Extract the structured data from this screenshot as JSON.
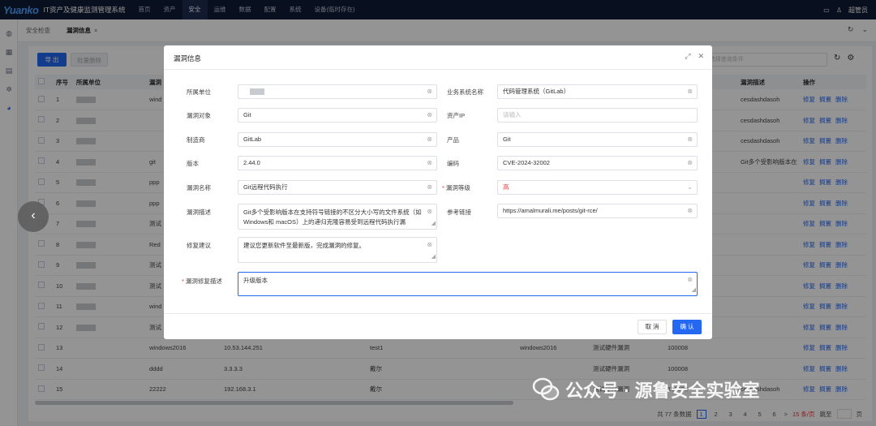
{
  "app": {
    "logo": "Yuanko",
    "title": "IT资产及健康监测管理系统",
    "user": "超管员"
  },
  "nav": [
    "首页",
    "资产",
    "安全",
    "运维",
    "数据",
    "配置",
    "系统",
    "设备(临时存在)"
  ],
  "tabs": [
    "安全检查",
    "漏洞信息"
  ],
  "toolbar": {
    "export": "导 出",
    "batch_delete": "批量删除",
    "search_placeholder": "请选择查询条件"
  },
  "table": {
    "headers": [
      "序号",
      "所属单位",
      "漏洞",
      "",
      "",
      "",
      "",
      "",
      "漏洞描述",
      "操作"
    ],
    "rows": [
      {
        "no": "1",
        "os": "wind",
        "c3": "",
        "c4": "",
        "c5": "",
        "c6": "",
        "c7": "",
        "desc": "cesdashdasoh"
      },
      {
        "no": "2",
        "os": "",
        "c3": "",
        "c4": "",
        "c5": "",
        "c6": "",
        "c7": "",
        "desc": "cesdashdasoh"
      },
      {
        "no": "3",
        "os": "",
        "c3": "",
        "c4": "",
        "c5": "",
        "c6": "",
        "c7": "",
        "desc": "cesdashdasoh"
      },
      {
        "no": "4",
        "os": "git",
        "c3": "",
        "c4": "",
        "c5": "",
        "c6": "",
        "c7": "2",
        "desc": "Git多个受影响版本在"
      },
      {
        "no": "5",
        "os": "ppp",
        "c3": "",
        "c4": "",
        "c5": "",
        "c6": "",
        "c7": "",
        "desc": ""
      },
      {
        "no": "6",
        "os": "ppp",
        "c3": "",
        "c4": "",
        "c5": "",
        "c6": "",
        "c7": "",
        "desc": ""
      },
      {
        "no": "7",
        "os": "测试",
        "c3": "",
        "c4": "",
        "c5": "",
        "c6": "",
        "c7": "",
        "desc": ""
      },
      {
        "no": "8",
        "os": "Red",
        "c3": "",
        "c4": "",
        "c5": "",
        "c6": "",
        "c7": "",
        "desc": ""
      },
      {
        "no": "9",
        "os": "测试",
        "c3": "",
        "c4": "",
        "c5": "",
        "c6": "",
        "c7": "",
        "desc": ""
      },
      {
        "no": "10",
        "os": "测试",
        "c3": "",
        "c4": "",
        "c5": "",
        "c6": "",
        "c7": "",
        "desc": ""
      },
      {
        "no": "11",
        "os": "wind",
        "c3": "",
        "c4": "",
        "c5": "",
        "c6": "",
        "c7": "",
        "desc": ""
      },
      {
        "no": "12",
        "os": "测试",
        "c3": "",
        "c4": "",
        "c5": "",
        "c6": "",
        "c7": "",
        "desc": ""
      },
      {
        "no": "13",
        "os": "windows2016",
        "c3": "10.53.144.251",
        "c4": "test1",
        "c5": "windows2016",
        "c6": "测试硬件漏洞",
        "c7": "100008",
        "desc": ""
      },
      {
        "no": "14",
        "os": "dddd",
        "c3": "3.3.3.3",
        "c4": "戴尔",
        "c5": "",
        "c6": "测试硬件漏洞",
        "c7": "100008",
        "desc": ""
      },
      {
        "no": "15",
        "os": "22222",
        "c3": "192.168.3.1",
        "c4": "戴尔",
        "c5": "",
        "c6": "测试硬件漏洞",
        "c7": "100008",
        "desc": "cesdashdasoh"
      }
    ],
    "ops": [
      "修复",
      "搁置",
      "删除"
    ]
  },
  "pager": {
    "total": "共 77 条数据",
    "pages": [
      "1",
      "2",
      "3",
      "4",
      "5",
      "6"
    ],
    "next": ">",
    "size": "15 条/页",
    "goto": "跳至",
    "page_unit": "页"
  },
  "modal": {
    "title": "漏洞信息",
    "labels": {
      "unit": "所属单位",
      "system": "业务系统名称",
      "target": "漏洞对象",
      "ip": "资产IP",
      "vendor": "制造商",
      "product": "产品",
      "version": "版本",
      "code": "编码",
      "name": "漏洞名称",
      "level": "漏洞等级",
      "desc": "漏洞描述",
      "ref": "参考链接",
      "advice": "修复建议",
      "fix_desc": "漏洞修复描述"
    },
    "values": {
      "unit": "",
      "system": "代码管理系统（GitLab）",
      "target": "Git",
      "ip_placeholder": "请输入",
      "vendor": "GitLab",
      "product": "Git",
      "version": "2.44.0",
      "code": "CVE-2024-32002",
      "name": "Git远程代码执行",
      "level": "高",
      "desc": "Git多个受影响版本在支持符号链接的不区分大小写的文件系统（如Windows和 macOS）上的递归克隆容易受到远程代码执行漏",
      "ref": "https://amalmurali.me/posts/git-rce/",
      "advice": "建议您更新软件至最新版，完成漏洞的修复。",
      "fix_desc": "升级版本"
    },
    "buttons": {
      "cancel": "取 消",
      "ok": "确 认"
    }
  },
  "watermark": "公众号 · 源鲁安全实验室",
  "colors": {
    "primary": "#2468f2",
    "danger": "#e4393c",
    "topbar": "#0f1a35"
  }
}
